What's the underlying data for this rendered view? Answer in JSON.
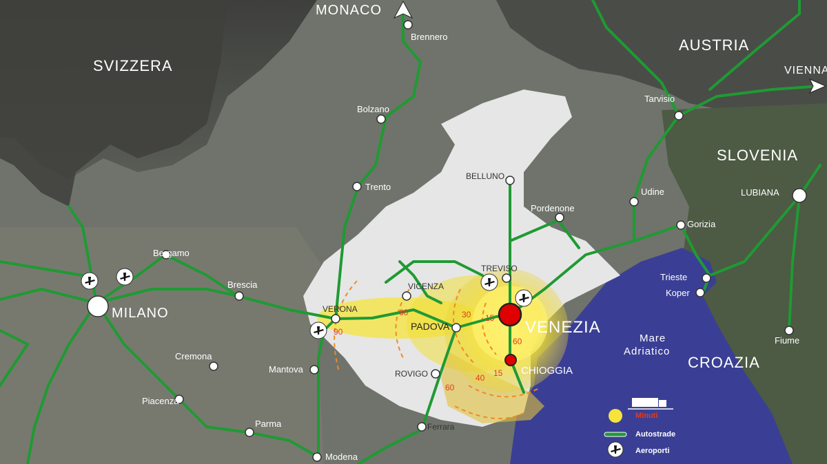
{
  "countries": {
    "svizzera": "SVIZZERA",
    "austria": "AUSTRIA",
    "slovenia": "SLOVENIA",
    "croazia": "CROAZIA"
  },
  "directions": {
    "monaco": "MONACO",
    "vienna": "VIENNA"
  },
  "sea": {
    "line1": "Mare",
    "line2": "Adriatico"
  },
  "cities": {
    "milano": "MILANO",
    "venezia": "VENEZIA",
    "chioggia": "CHIOGGIA",
    "verona": "VERONA",
    "padova": "PADOVA",
    "vicenza": "VICENZA",
    "treviso": "TREVISO",
    "rovigo": "ROVIGO",
    "belluno": "BELLUNO",
    "brennero": "Brennero",
    "bolzano": "Bolzano",
    "trento": "Trento",
    "bergamo": "Bergamo",
    "brescia": "Brescia",
    "cremona": "Cremona",
    "mantova": "Mantova",
    "piacenza": "Piacenza",
    "parma": "Parma",
    "modena": "Modena",
    "ferrara": "Ferrara",
    "pordenone": "Pordenone",
    "udine": "Udine",
    "gorizia": "Gorizia",
    "tarvisio": "Tarvisio",
    "trieste": "Trieste",
    "koper": "Koper",
    "lubiana": "LUBIANA",
    "fiume": "Fiume"
  },
  "isochrones": {
    "m15a": "15",
    "m15b": "15",
    "m30": "30",
    "m40": "40",
    "m60a": "60",
    "m60b": "60",
    "m60c": "60",
    "m90": "90"
  },
  "legend": {
    "minuti": "Minuti",
    "autostrade": "Autostrade",
    "aeroporti": "Aeroporti"
  },
  "colors": {
    "highway": "#1f9a33",
    "sea": "#3a3f95",
    "veneto": "#e6e6e6",
    "isochrone": "#f5e43a",
    "city_marker": "#e00000",
    "minuti_label": "#e23b1e"
  }
}
